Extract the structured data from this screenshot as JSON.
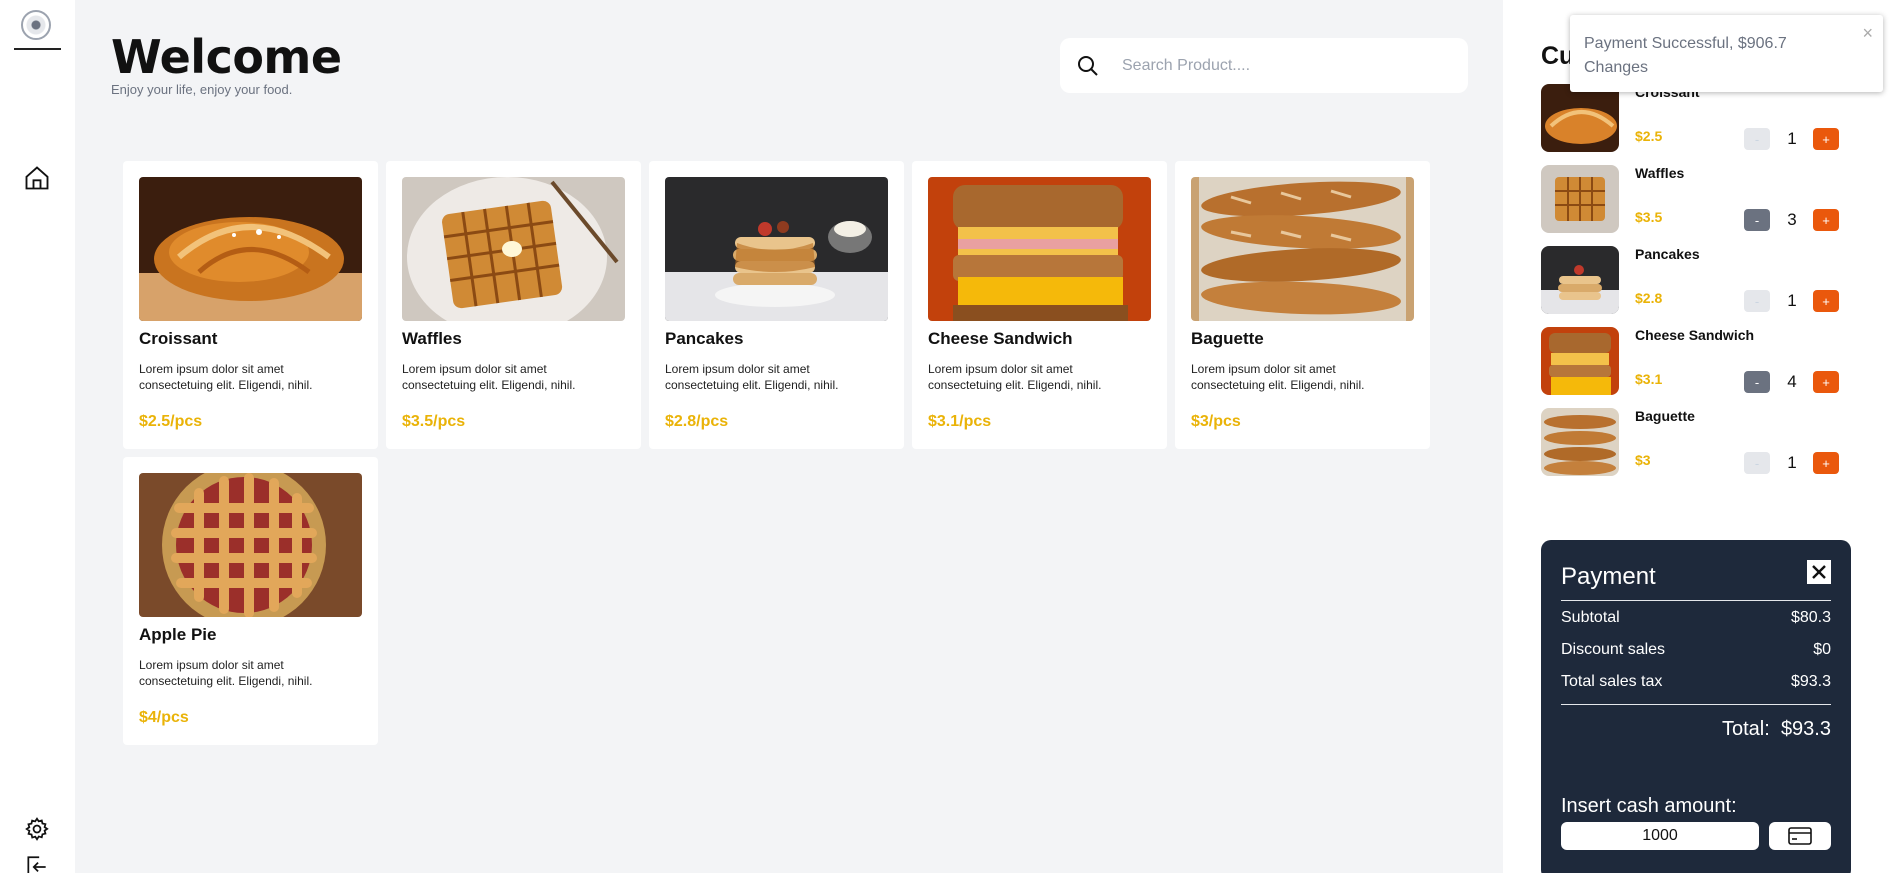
{
  "header": {
    "title": "Welcome",
    "tagline": "Enjoy your life, enjoy your food."
  },
  "search": {
    "placeholder": "Search Product....",
    "value": ""
  },
  "products": [
    {
      "name": "Croissant",
      "description": "Lorem ipsum dolor sit amet consectetuing elit. Eligendi, nihil.",
      "price": "$2.5/pcs",
      "image": "croissant"
    },
    {
      "name": "Waffles",
      "description": "Lorem ipsum dolor sit amet consectetuing elit. Eligendi, nihil.",
      "price": "$3.5/pcs",
      "image": "waffles"
    },
    {
      "name": "Pancakes",
      "description": "Lorem ipsum dolor sit amet consectetuing elit. Eligendi, nihil.",
      "price": "$2.8/pcs",
      "image": "pancakes"
    },
    {
      "name": "Cheese Sandwich",
      "description": "Lorem ipsum dolor sit amet consectetuing elit. Eligendi, nihil.",
      "price": "$3.1/pcs",
      "image": "sandwich"
    },
    {
      "name": "Baguette",
      "description": "Lorem ipsum dolor sit amet consectetuing elit. Eligendi, nihil.",
      "price": "$3/pcs",
      "image": "baguette"
    },
    {
      "name": "Apple Pie",
      "description": "Lorem ipsum dolor sit amet consectetuing elit. Eligendi, nihil.",
      "price": "$4/pcs",
      "image": "applepie"
    }
  ],
  "cart": {
    "title": "Current Order",
    "items": [
      {
        "name": "Croissant",
        "price": "$2.5",
        "qty": "1",
        "minus_label": "-",
        "plus_label": "+",
        "minus_enabled": false
      },
      {
        "name": "Waffles",
        "price": "$3.5",
        "qty": "3",
        "minus_label": "-",
        "plus_label": "+",
        "minus_enabled": true
      },
      {
        "name": "Pancakes",
        "price": "$2.8",
        "qty": "1",
        "minus_label": "-",
        "plus_label": "+",
        "minus_enabled": false
      },
      {
        "name": "Cheese Sandwich",
        "price": "$3.1",
        "qty": "4",
        "minus_label": "-",
        "plus_label": "+",
        "minus_enabled": true
      },
      {
        "name": "Baguette",
        "price": "$3",
        "qty": "1",
        "minus_label": "-",
        "plus_label": "+",
        "minus_enabled": false
      }
    ]
  },
  "payment": {
    "title": "Payment",
    "subtotal_label": "Subtotal",
    "subtotal": "$80.3",
    "discount_label": "Discount sales",
    "discount": "$0",
    "tax_label": "Total sales tax",
    "tax": "$93.3",
    "total_label": "Total:",
    "total": "$93.3",
    "cash_label": "Insert cash amount:",
    "cash_value": "1000"
  },
  "toast": {
    "message": "Payment Successful, $906.7 Changes",
    "close": "×"
  },
  "icons": {
    "home": "home-icon",
    "settings": "gear-icon",
    "logout": "logout-icon",
    "search": "search-icon",
    "card": "credit-card-icon",
    "close": "close-icon"
  },
  "colors": {
    "accent": "#ea580c",
    "price": "#eab308",
    "payment_bg": "#1e293b",
    "bg": "#f3f4f6"
  }
}
